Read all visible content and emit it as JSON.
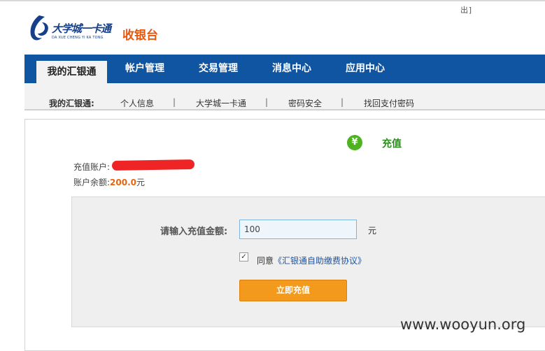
{
  "header": {
    "logout_label": "出]",
    "logo_text": "大学城一卡通",
    "logo_subtext": "DA XUE CHENG YI KA TONG",
    "cashier_title": "收银台"
  },
  "nav": {
    "tabs": [
      {
        "label": "我的汇银通",
        "active": true
      },
      {
        "label": "帐户管理"
      },
      {
        "label": "交易管理"
      },
      {
        "label": "消息中心"
      },
      {
        "label": "应用中心"
      }
    ]
  },
  "subnav": {
    "title": "我的汇银通:",
    "items": [
      "个人信息",
      "大学城一卡通",
      "密码安全",
      "找回支付密码"
    ],
    "separator": "|"
  },
  "recharge": {
    "icon": "yen-icon",
    "title": "充值",
    "account_label": "充值账户:",
    "balance_label": "账户余额:",
    "balance_value": "200.0",
    "balance_unit": "元"
  },
  "form": {
    "amount_label": "请输入充值金额:",
    "amount_value": "100",
    "amount_unit": "元",
    "agree_checked": true,
    "agree_prefix": "同意",
    "agree_link": "《汇银通自助缴费协议》",
    "submit_label": "立即充值"
  },
  "watermark": "www.wooyun.org",
  "colors": {
    "nav_bg": "#0f55a2",
    "accent_orange": "#e8570c",
    "button_orange": "#f39a1d",
    "success_green": "#4db320",
    "link_blue": "#1b55a7"
  }
}
